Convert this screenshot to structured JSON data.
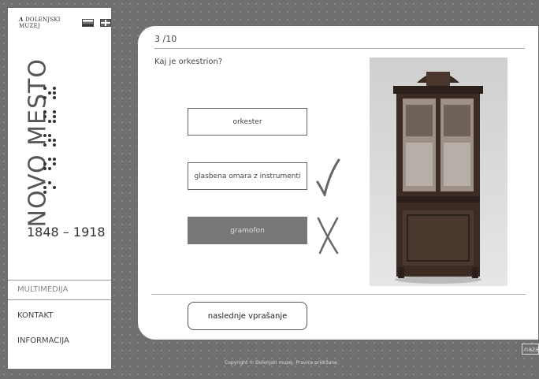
{
  "sidebar": {
    "logo_text": "DOLENJSKI MUZEJ",
    "city": "NOVO MESTO",
    "years": "1848 – 1918",
    "menu": [
      {
        "label": "MULTIMEDIJA",
        "active": true
      },
      {
        "label": "KONTAKT",
        "active": false
      },
      {
        "label": "INFORMACIJA",
        "active": false
      }
    ]
  },
  "quiz": {
    "counter": "3 /10",
    "question": "Kaj je orkestrion?",
    "answers": [
      {
        "label": "orkester",
        "state": "neutral"
      },
      {
        "label": "glasbena omara z instrumenti",
        "state": "correct"
      },
      {
        "label": "gramofon",
        "state": "wrong"
      }
    ],
    "next_label": "naslednje vprašanje"
  },
  "footer": {
    "copyright": "Copyright © Dolenjski muzej. Pravice pridržane.",
    "back_label": "nazaj"
  },
  "icons": [
    "flag-si-icon",
    "flag-uk-icon",
    "check-icon",
    "cross-icon"
  ]
}
